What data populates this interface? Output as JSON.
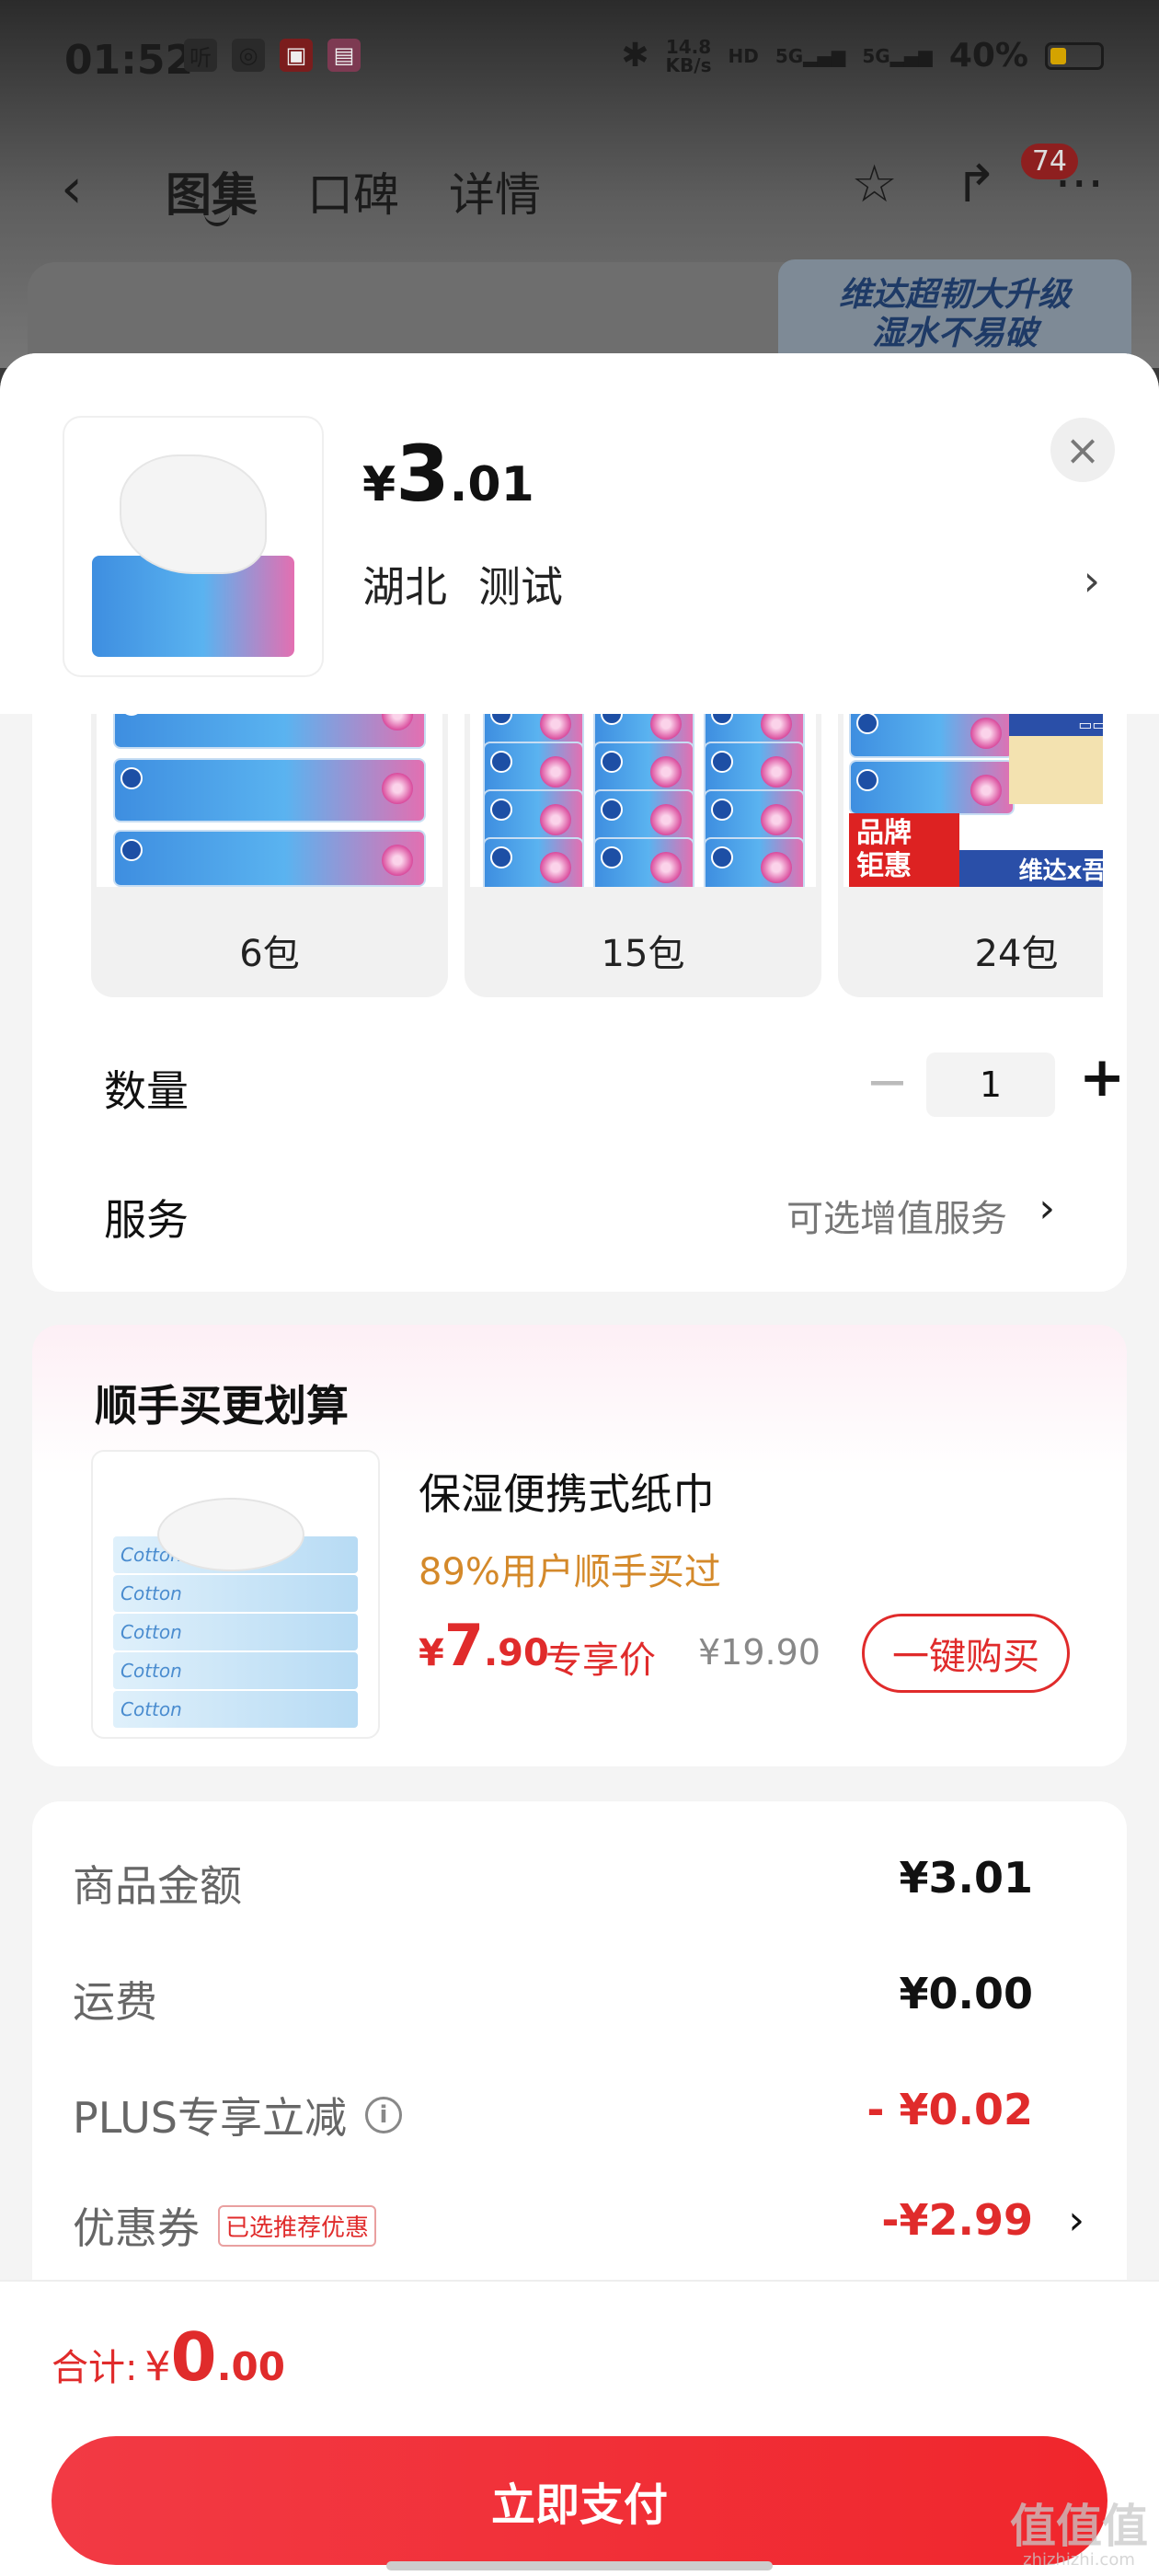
{
  "status_bar": {
    "time": "01:52",
    "listen_icon_text": "听",
    "net_speed_value": "14.8",
    "net_speed_unit": "KB/s",
    "hd_label": "HD",
    "sim1": "5G",
    "sim2": "5G",
    "battery_percent": "40%",
    "battery_level": 0.4
  },
  "nav": {
    "tabs": [
      {
        "label": "图集",
        "active": true
      },
      {
        "label": "口碑",
        "active": false
      },
      {
        "label": "详情",
        "active": false
      }
    ],
    "message_count": "74"
  },
  "background_banner": {
    "line1": "维达超韧大升级",
    "line2": "湿水不易破"
  },
  "product": {
    "price_yen": "¥",
    "price_int": "3",
    "price_dec": ".01",
    "region": "湖北",
    "address_name": "测试"
  },
  "specs": [
    {
      "label": "6包"
    },
    {
      "label": "15包"
    },
    {
      "label": "24包",
      "badge": "品牌\n钜惠",
      "strip": "维达x吾皇"
    }
  ],
  "quantity": {
    "label": "数量",
    "value": "1",
    "minus": "−",
    "plus": "+"
  },
  "service": {
    "label": "服务",
    "value": "可选增值服务"
  },
  "addon": {
    "title": "顺手买更划算",
    "product_name": "保湿便携式纸巾",
    "social_proof": "89%用户顺手买过",
    "price_yen": "¥",
    "price_int": "7",
    "price_dec": ".90",
    "price_tag": "专享价",
    "original_price": "¥19.90",
    "button": "一键购买"
  },
  "summary": {
    "rows": [
      {
        "label": "商品金额",
        "value": "¥3.01"
      },
      {
        "label": "运费",
        "value": "¥0.00"
      },
      {
        "label": "PLUS专享立减",
        "value": "- ¥0.02"
      },
      {
        "label": "优惠券",
        "tag": "已选推荐优惠",
        "value": "-¥2.99"
      }
    ]
  },
  "footer": {
    "total_label": "合计:",
    "total_yen": "¥",
    "total_int": "0",
    "total_dec": ".00",
    "pay_button": "立即支付"
  },
  "watermark": {
    "text": "值值值",
    "domain": "zhizhizhi.com"
  },
  "colors": {
    "accent_red": "#e02b2b",
    "pay_button": "#f0262c",
    "social_proof_orange": "#d4892a"
  }
}
